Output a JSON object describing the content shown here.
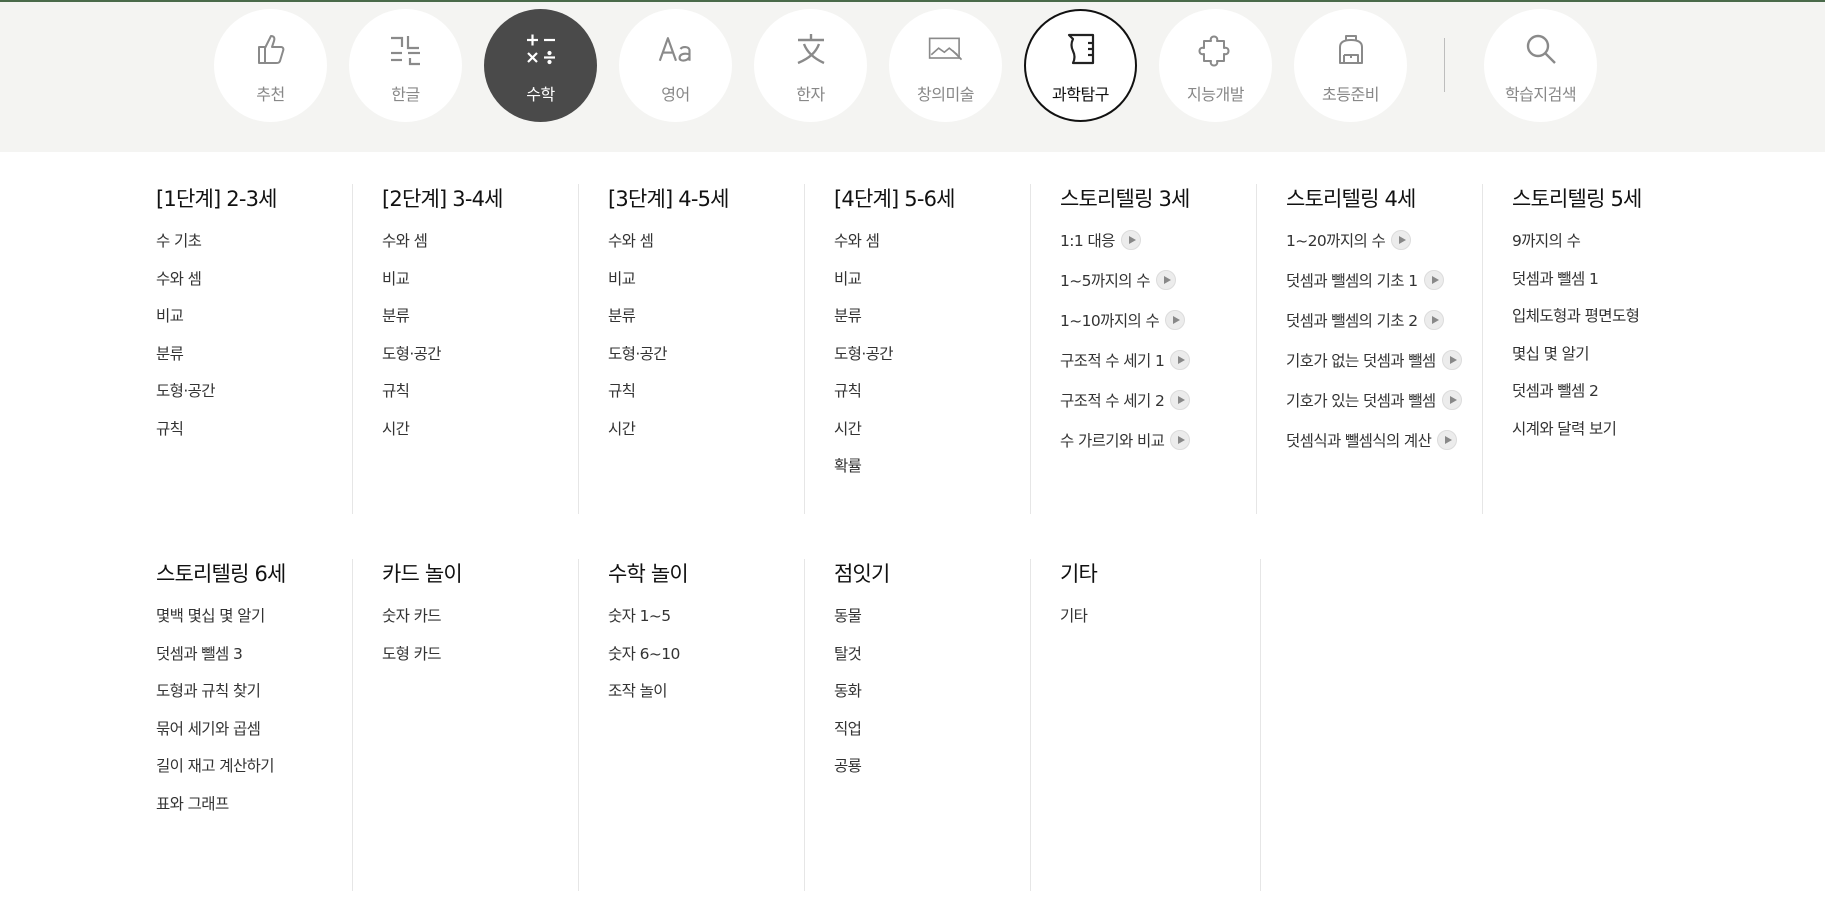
{
  "nav": {
    "categories": [
      {
        "label": "추천",
        "icon": "thumbs-up-icon"
      },
      {
        "label": "한글",
        "icon": "hangul-icon"
      },
      {
        "label": "수학",
        "icon": "math-operators-icon"
      },
      {
        "label": "영어",
        "icon": "aa-letters-icon"
      },
      {
        "label": "한자",
        "icon": "chinese-character-icon"
      },
      {
        "label": "창의미술",
        "icon": "picture-brush-icon"
      },
      {
        "label": "과학탐구",
        "icon": "beaker-icon"
      },
      {
        "label": "지능개발",
        "icon": "puzzle-icon"
      },
      {
        "label": "초등준비",
        "icon": "backpack-icon"
      }
    ],
    "search_label": "학습지검색",
    "search_icon": "magnifier-icon",
    "active_category": "수학",
    "colors": {
      "active_bg": "#4a4a4a",
      "topline": "#4a6a4a"
    }
  },
  "menu": {
    "row1": [
      {
        "title": "[1단계] 2-3세",
        "items": [
          "수 기초",
          "수와 셈",
          "비교",
          "분류",
          "도형·공간",
          "규칙"
        ]
      },
      {
        "title": "[2단계] 3-4세",
        "items": [
          "수와 셈",
          "비교",
          "분류",
          "도형·공간",
          "규칙",
          "시간"
        ]
      },
      {
        "title": "[3단계] 4-5세",
        "items": [
          "수와 셈",
          "비교",
          "분류",
          "도형·공간",
          "규칙",
          "시간"
        ]
      },
      {
        "title": "[4단계] 5-6세",
        "items": [
          "수와 셈",
          "비교",
          "분류",
          "도형·공간",
          "규칙",
          "시간",
          "확률"
        ]
      },
      {
        "title": "스토리텔링 3세",
        "items": [
          "1:1 대응",
          "1~5까지의 수",
          "1~10까지의 수",
          "구조적 수 세기 1",
          "구조적 수 세기 2",
          "수 가르기와 비교"
        ]
      },
      {
        "title": "스토리텔링 4세",
        "items": [
          "1~20까지의 수",
          "덧셈과 뺄셈의 기초 1",
          "덧셈과 뺄셈의 기초 2",
          "기호가 없는 덧셈과 뺄셈",
          "기호가 있는 덧셈과 뺄셈",
          "덧셈식과 뺄셈식의 계산"
        ]
      },
      {
        "title": "스토리텔링 5세",
        "items": [
          "9까지의 수",
          "덧셈과 뺄셈 1",
          "입체도형과 평면도형",
          "몇십 몇 알기",
          "덧셈과 뺄셈 2",
          "시계와 달력 보기"
        ]
      }
    ],
    "row2": [
      {
        "title": "스토리텔링 6세",
        "items": [
          "몇백 몇십 몇 알기",
          "덧셈과 뺄셈 3",
          "도형과 규칙 찾기",
          "묶어 세기와 곱셈",
          "길이 재고 계산하기",
          "표와 그래프"
        ]
      },
      {
        "title": "카드 놀이",
        "items": [
          "숫자 카드",
          "도형 카드"
        ]
      },
      {
        "title": "수학 놀이",
        "items": [
          "숫자 1~5",
          "숫자 6~10",
          "조작 놀이"
        ]
      },
      {
        "title": "점잇기",
        "items": [
          "동물",
          "탈것",
          "동화",
          "직업",
          "공룡"
        ]
      },
      {
        "title": "기타",
        "items": [
          "기타"
        ]
      }
    ]
  }
}
